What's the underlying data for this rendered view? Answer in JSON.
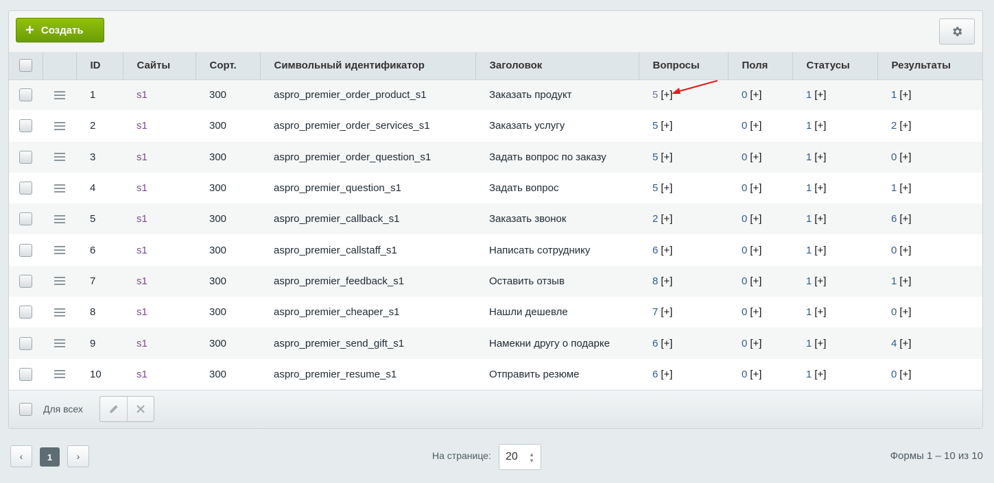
{
  "toolbar": {
    "create_label": "Создать",
    "create_icon": "plus-icon",
    "settings_icon": "gear-icon"
  },
  "table": {
    "headers": [
      "ID",
      "Сайты",
      "Сорт.",
      "Символьный идентификатор",
      "Заголовок",
      "Вопросы",
      "Поля",
      "Статусы",
      "Результаты"
    ],
    "plus_text": "[+]",
    "rows": [
      {
        "id": "1",
        "site": "s1",
        "sort": "300",
        "sid": "aspro_premier_order_product_s1",
        "title": "Заказать продукт",
        "questions": "5",
        "fields": "0",
        "statuses": "1",
        "results": "1"
      },
      {
        "id": "2",
        "site": "s1",
        "sort": "300",
        "sid": "aspro_premier_order_services_s1",
        "title": "Заказать услугу",
        "questions": "5",
        "fields": "0",
        "statuses": "1",
        "results": "2"
      },
      {
        "id": "3",
        "site": "s1",
        "sort": "300",
        "sid": "aspro_premier_order_question_s1",
        "title": "Задать вопрос по заказу",
        "questions": "5",
        "fields": "0",
        "statuses": "1",
        "results": "0"
      },
      {
        "id": "4",
        "site": "s1",
        "sort": "300",
        "sid": "aspro_premier_question_s1",
        "title": "Задать вопрос",
        "questions": "5",
        "fields": "0",
        "statuses": "1",
        "results": "1"
      },
      {
        "id": "5",
        "site": "s1",
        "sort": "300",
        "sid": "aspro_premier_callback_s1",
        "title": "Заказать звонок",
        "questions": "2",
        "fields": "0",
        "statuses": "1",
        "results": "6"
      },
      {
        "id": "6",
        "site": "s1",
        "sort": "300",
        "sid": "aspro_premier_callstaff_s1",
        "title": "Написать сотруднику",
        "questions": "6",
        "fields": "0",
        "statuses": "1",
        "results": "0"
      },
      {
        "id": "7",
        "site": "s1",
        "sort": "300",
        "sid": "aspro_premier_feedback_s1",
        "title": "Оставить отзыв",
        "questions": "8",
        "fields": "0",
        "statuses": "1",
        "results": "1"
      },
      {
        "id": "8",
        "site": "s1",
        "sort": "300",
        "sid": "aspro_premier_cheaper_s1",
        "title": "Нашли дешевле",
        "questions": "7",
        "fields": "0",
        "statuses": "1",
        "results": "0"
      },
      {
        "id": "9",
        "site": "s1",
        "sort": "300",
        "sid": "aspro_premier_send_gift_s1",
        "title": "Намекни другу о подарке",
        "questions": "6",
        "fields": "0",
        "statuses": "1",
        "results": "4"
      },
      {
        "id": "10",
        "site": "s1",
        "sort": "300",
        "sid": "aspro_premier_resume_s1",
        "title": "Отправить резюме",
        "questions": "6",
        "fields": "0",
        "statuses": "1",
        "results": "0"
      }
    ]
  },
  "footer": {
    "for_all_label": "Для всех",
    "edit_icon": "pencil-icon",
    "delete_icon": "close-icon"
  },
  "pagination": {
    "current_page": "1",
    "per_page_label": "На странице:",
    "per_page_value": "20",
    "summary": "Формы 1 – 10 из 10"
  },
  "annotation": {
    "arrow_color": "#e0201a"
  }
}
